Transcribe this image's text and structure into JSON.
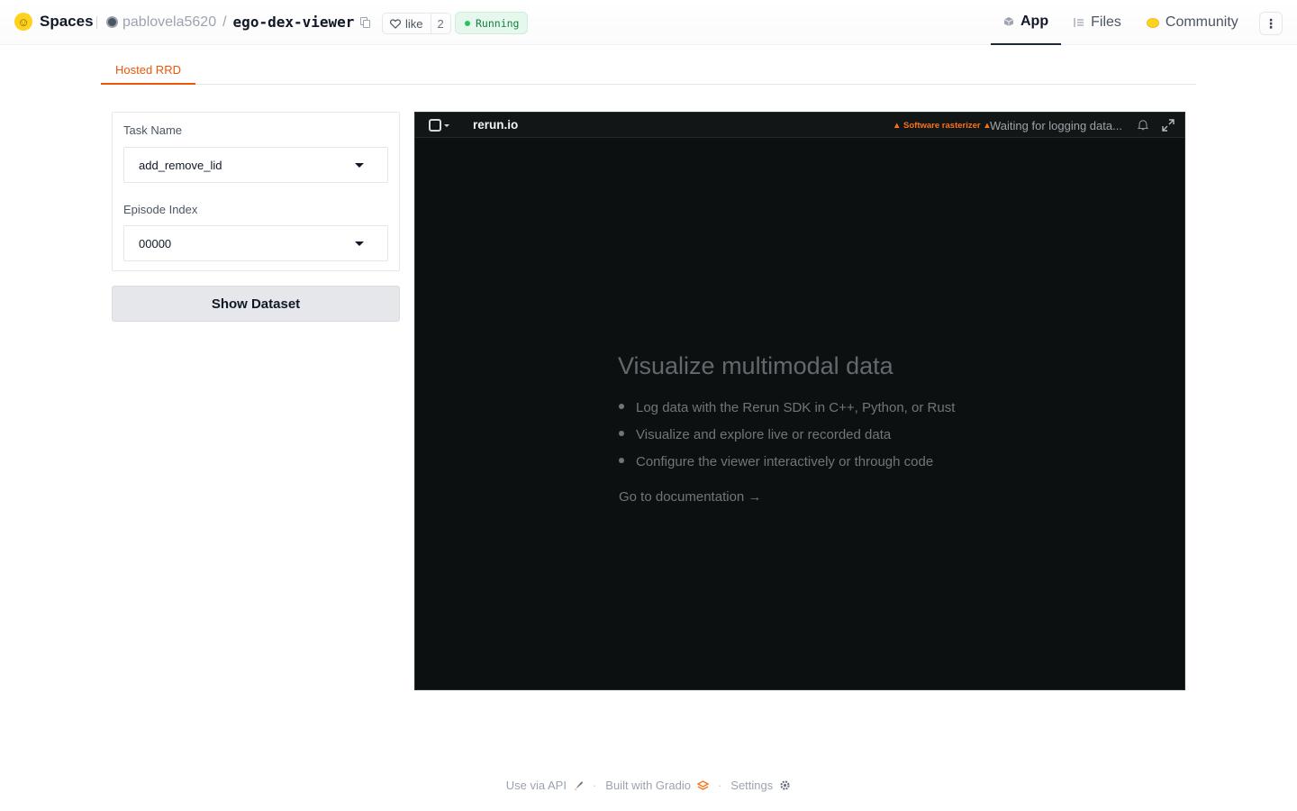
{
  "header": {
    "brand": "Spaces",
    "owner": "pablovela5620",
    "separator": "/",
    "repo": "ego-dex-viewer",
    "like_label": "like",
    "like_count": "2",
    "status": "Running",
    "nav": [
      {
        "label": "App",
        "icon": "cube-icon",
        "active": true
      },
      {
        "label": "Files",
        "icon": "files-icon",
        "active": false
      },
      {
        "label": "Community",
        "icon": "community-icon",
        "active": false
      }
    ]
  },
  "tabs": [
    {
      "label": "Hosted RRD",
      "active": true
    }
  ],
  "form": {
    "task_label": "Task Name",
    "task_value": "add_remove_lid",
    "episode_label": "Episode Index",
    "episode_value": "00000",
    "submit_label": "Show Dataset"
  },
  "viewer": {
    "brand": "rerun.io",
    "warning": "Software rasterizer",
    "status": "Waiting for logging data...",
    "welcome_title": "Visualize multimodal data",
    "bullets": [
      "Log data with the Rerun SDK in C++, Python, or Rust",
      "Visualize and explore live or recorded data",
      "Configure the viewer interactively or through code"
    ],
    "doc_link": "Go to documentation →"
  },
  "footer": {
    "api": "Use via API",
    "built": "Built with Gradio",
    "settings": "Settings",
    "dot": "·"
  },
  "colors": {
    "accent": "#ea580c",
    "running_bg": "#e6f8ee",
    "running_text": "#15803d",
    "viewer_bg": "#0d1011",
    "warning": "#f97316"
  }
}
